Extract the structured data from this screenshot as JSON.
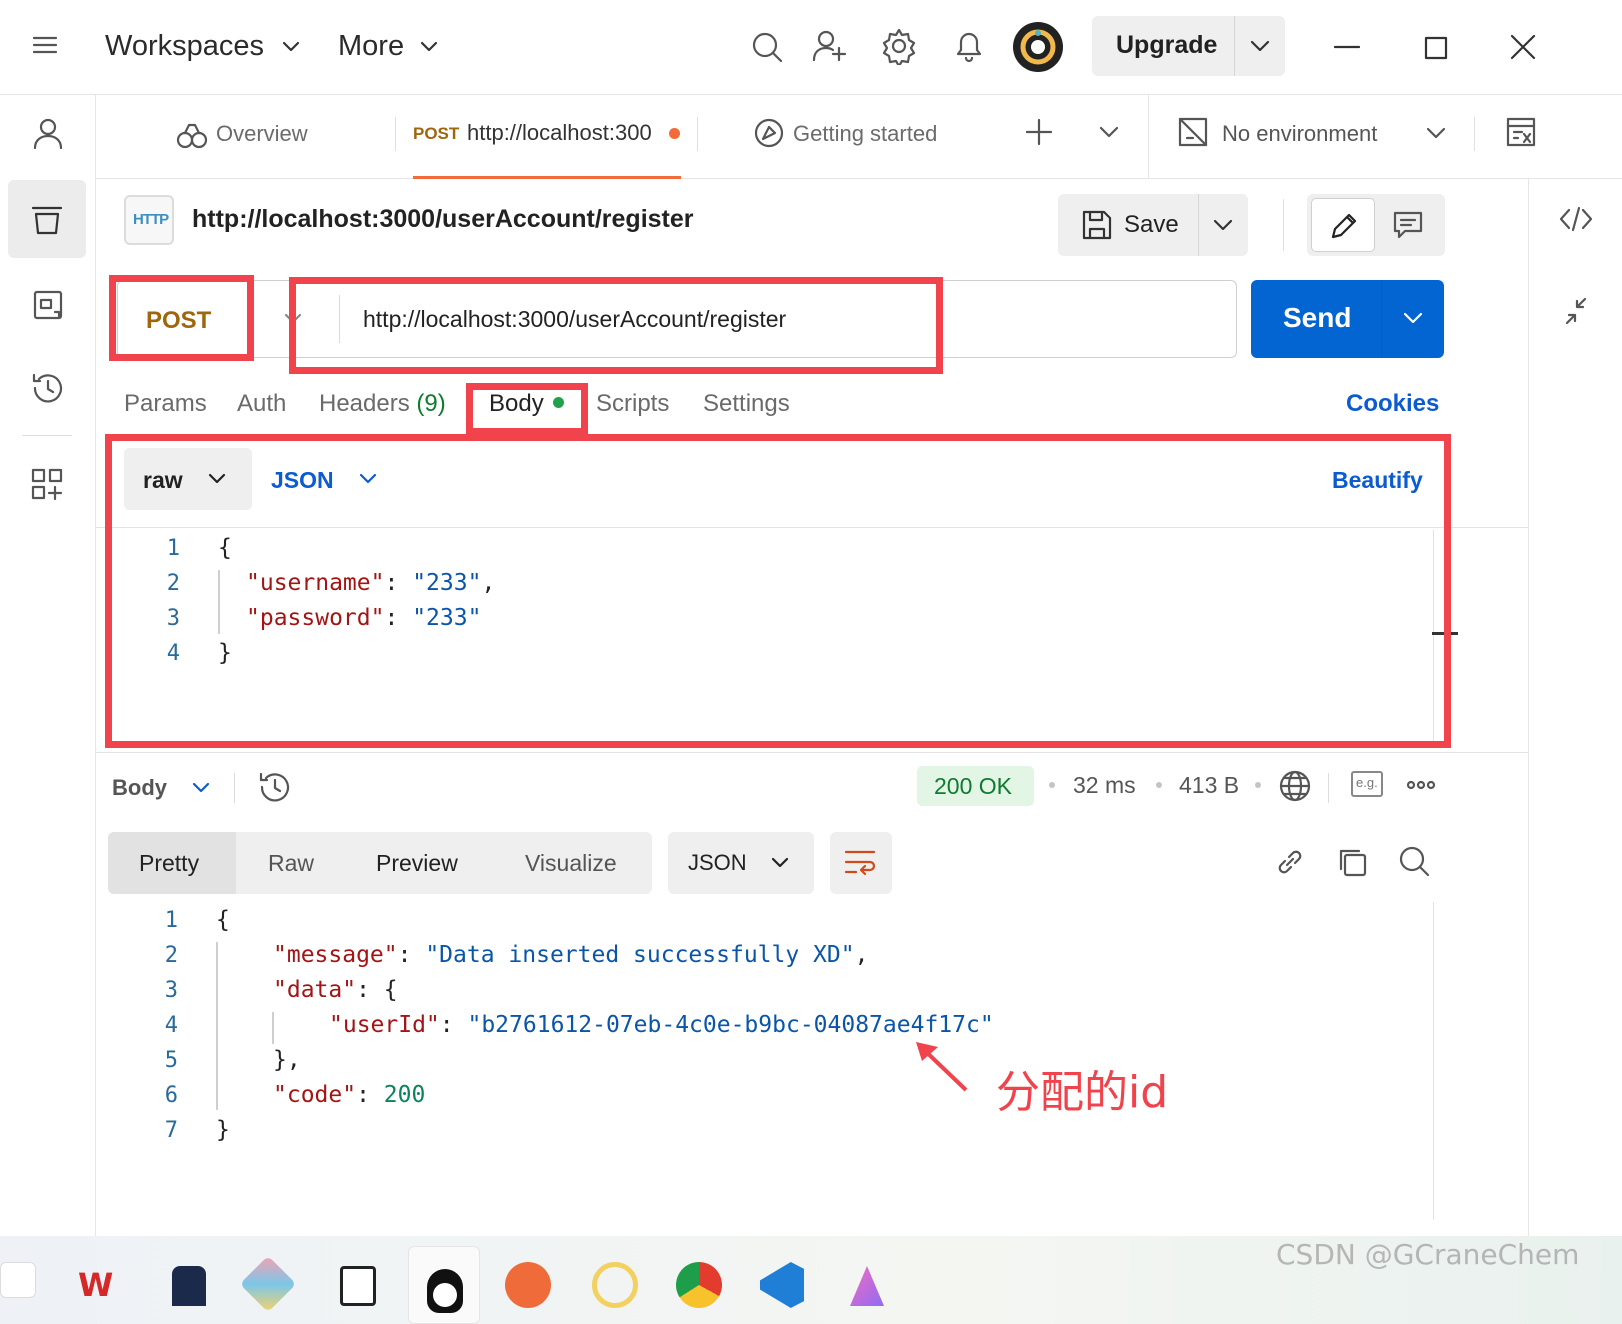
{
  "topbar": {
    "workspaces": "Workspaces",
    "more": "More",
    "upgrade": "Upgrade"
  },
  "tabs": [
    {
      "label": "Overview"
    },
    {
      "method": "POST",
      "label": "http://localhost:300"
    },
    {
      "label": "Getting started"
    }
  ],
  "environment": "No environment",
  "request": {
    "title": "http://localhost:3000/userAccount/register",
    "save": "Save",
    "method": "POST",
    "url": "http://localhost:3000/userAccount/register",
    "send": "Send"
  },
  "req_tabs": {
    "params": "Params",
    "auth": "Auth",
    "headers": "Headers",
    "headers_count": "(9)",
    "body": "Body",
    "scripts": "Scripts",
    "settings": "Settings",
    "cookies": "Cookies"
  },
  "body_opts": {
    "raw": "raw",
    "json": "JSON",
    "beautify": "Beautify"
  },
  "request_body": {
    "lines": [
      "1",
      "2",
      "3",
      "4"
    ],
    "username_key": "\"username\"",
    "username_val": "\"233\"",
    "password_key": "\"password\"",
    "password_val": "\"233\""
  },
  "response": {
    "label": "Body",
    "status": "200 OK",
    "time": "32 ms",
    "size": "413 B",
    "eg": "e.g.",
    "views": [
      "Pretty",
      "Raw",
      "Preview",
      "Visualize"
    ],
    "format": "JSON",
    "lines": [
      "1",
      "2",
      "3",
      "4",
      "5",
      "6",
      "7"
    ],
    "message_key": "\"message\"",
    "message_val": "\"Data inserted successfully XD\"",
    "data_key": "\"data\"",
    "userid_key": "\"userId\"",
    "userid_val": "\"b2761612-07eb-4c0e-b9bc-04087ae4f17c\"",
    "code_key": "\"code\"",
    "code_val": "200"
  },
  "annotation": "分配的id",
  "watermark": "CSDN @GCraneChem",
  "colors": {
    "accent": "#0265d2",
    "post": "#a0660b",
    "red": "#f0434c",
    "ok_bg": "#e3f6e6",
    "ok_text": "#0f7b2f",
    "link": "#0b5bd1"
  }
}
